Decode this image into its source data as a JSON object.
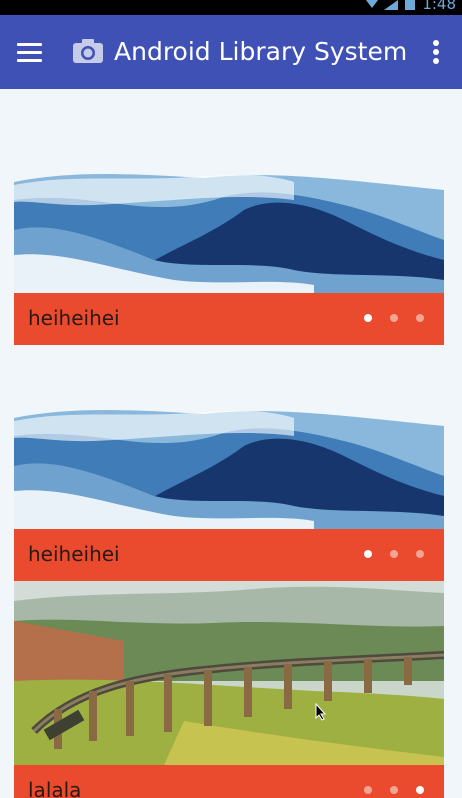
{
  "status_bar": {
    "time": "1:48"
  },
  "app_bar": {
    "title": "Android Library System",
    "menu_icon": "hamburger-menu-icon",
    "app_icon": "camera-icon",
    "overflow_icon": "more-vert-icon"
  },
  "banners": [
    {
      "caption": "heiheihei",
      "active_page": 1,
      "pages": 3,
      "image": "mountains-clouds"
    },
    {
      "caption": "heiheihei",
      "active_page": 1,
      "pages": 3,
      "image": "mountains-clouds"
    },
    {
      "caption": "lalala",
      "active_page": 3,
      "pages": 3,
      "image": "railway-viaduct"
    }
  ],
  "colors": {
    "app_bar": "#3f51b5",
    "caption_bar": "#ea4a2d",
    "background": "#f0f6f9"
  }
}
